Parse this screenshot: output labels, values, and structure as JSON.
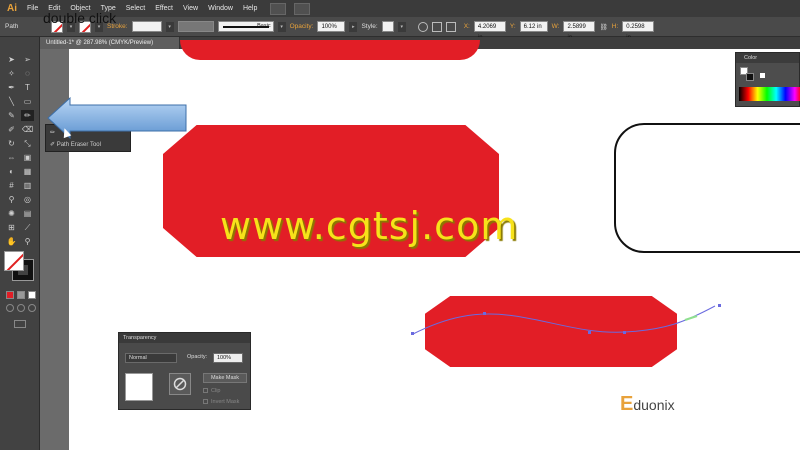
{
  "app": {
    "logo": "Ai"
  },
  "menu": {
    "items": [
      "File",
      "Edit",
      "Object",
      "Type",
      "Select",
      "Effect",
      "View",
      "Window",
      "Help"
    ]
  },
  "control_bar": {
    "selection_label": "Path",
    "stroke_label": "Stroke:",
    "stroke_profile": "Basic",
    "opacity_label": "Opacity:",
    "opacity_value": "100%",
    "style_label": "Style:",
    "x_label": "X:",
    "x_value": "4.2069 in",
    "y_label": "Y:",
    "y_value": "6.12 in",
    "w_label": "W:",
    "w_value": "2.5899 in",
    "h_label": "H:",
    "h_value": "0.2598 in"
  },
  "document_tab": {
    "title": "Untitled-1* @ 287.98% (CMYK/Preview)"
  },
  "callout": {
    "text": "double click"
  },
  "flyout": {
    "item2": "Path Eraser Tool"
  },
  "watermark": {
    "text": "www.cgtsj.com"
  },
  "color_panel": {
    "title": "Color"
  },
  "transparency_panel": {
    "title": "Transparency",
    "blend_mode": "Normal",
    "opacity_label": "Opacity:",
    "opacity_value": "100%",
    "make_mask": "Make Mask",
    "clip": "Clip",
    "invert_mask": "Invert Mask"
  },
  "brand": {
    "initial": "E",
    "rest": "duonix"
  },
  "colors": {
    "red_fill": "#e21e26",
    "path_stroke": "#6a6adf",
    "accent": "#e8a23b"
  }
}
